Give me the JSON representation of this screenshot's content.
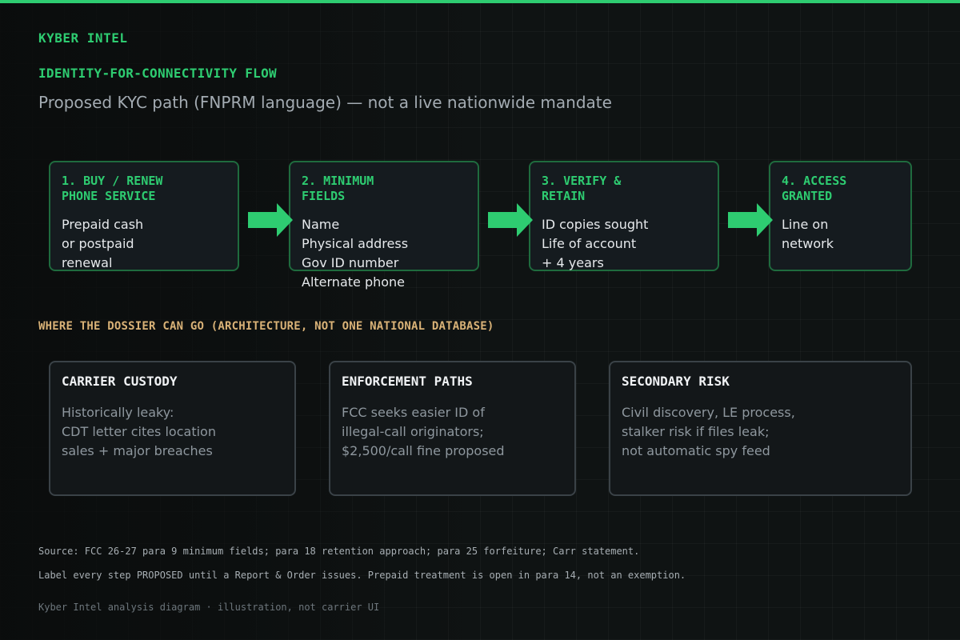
{
  "header": {
    "brand": "KYBER INTEL",
    "flow_title": "IDENTITY-FOR-CONNECTIVITY FLOW",
    "subtitle": "Proposed KYC path (FNPRM language) — not a live nationwide mandate"
  },
  "steps": [
    {
      "title": "1. BUY / RENEW\nPHONE SERVICE",
      "lines": [
        "Prepaid cash",
        "or postpaid",
        "renewal"
      ]
    },
    {
      "title": "2. MINIMUM\nFIELDS",
      "lines": [
        "Name",
        "Physical address",
        "Gov ID number",
        "Alternate phone"
      ]
    },
    {
      "title": "3. VERIFY &\nRETAIN",
      "lines": [
        "ID copies sought",
        "Life of account",
        "+ 4 years"
      ]
    },
    {
      "title": "4. ACCESS\nGRANTED",
      "lines": [
        "Line on",
        "network"
      ]
    }
  ],
  "dossier": {
    "title": "WHERE THE DOSSIER CAN GO (ARCHITECTURE, NOT ONE NATIONAL DATABASE)",
    "cards": [
      {
        "title": "CARRIER CUSTODY",
        "lines": [
          "Historically leaky:",
          "CDT letter cites location",
          "sales + major breaches"
        ]
      },
      {
        "title": "ENFORCEMENT PATHS",
        "lines": [
          "FCC seeks easier ID of",
          "illegal-call originators;",
          "$2,500/call fine proposed"
        ]
      },
      {
        "title": "SECONDARY RISK",
        "lines": [
          "Civil discovery, LE process,",
          "stalker risk if files leak;",
          "not automatic spy feed"
        ]
      }
    ]
  },
  "notes": {
    "source": "Source: FCC 26-27 para 9 minimum fields; para 18 retention approach; para 25 forfeiture; Carr statement.",
    "label_note": "Label every step PROPOSED until a Report & Order issues. Prepaid treatment is open in para 14, not an exemption.",
    "footer": "Kyber Intel analysis diagram · illustration, not carrier UI"
  },
  "colors": {
    "accent": "#2ecc71",
    "dossier_title": "#d9b277",
    "background": "#0f1313"
  }
}
